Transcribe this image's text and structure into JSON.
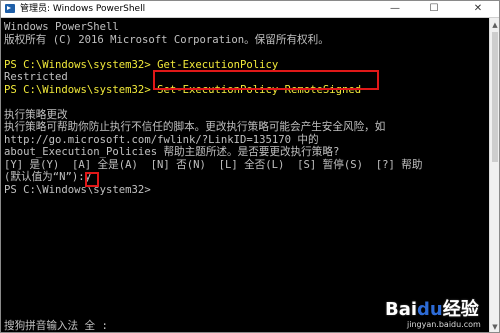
{
  "window": {
    "title": "管理员: Windows PowerShell",
    "minimize_glyph": "—",
    "maximize_glyph": "☐",
    "close_glyph": "✕"
  },
  "console": {
    "lines": [
      "Windows PowerShell",
      "版权所有 (C) 2016 Microsoft Corporation。保留所有权利。",
      "",
      "PS C:\\Windows\\system32> Get-ExecutionPolicy",
      "Restricted",
      "PS C:\\Windows\\system32> Set-ExecutionPolicy RemoteSigned",
      "",
      "执行策略更改",
      "执行策略可帮助你防止执行不信任的脚本。更改执行策略可能会产生安全风险，如",
      "http://go.microsoft.com/fwlink/?LinkID=135170 中的",
      "about_Execution_Policies 帮助主题所述。是否要更改执行策略?",
      "[Y] 是(Y)  [A] 全是(A)  [N] 否(N)  [L] 全否(L)  [S] 暂停(S)  [?] 帮助",
      "(默认值为“N”):y",
      "PS C:\\Windows\\system32>"
    ],
    "ime_status": "搜狗拼音输入法 全 :",
    "highlight_color": "#f2ea3a",
    "text_color": "#c0c0c0",
    "annotation_color": "#e01818"
  },
  "scrollbar": {
    "up_glyph": "▲",
    "down_glyph": "▼"
  },
  "watermark": {
    "logo": "Bai",
    "paw": "du",
    "suffix": "经验",
    "url": "jingyan.baidu.com"
  }
}
